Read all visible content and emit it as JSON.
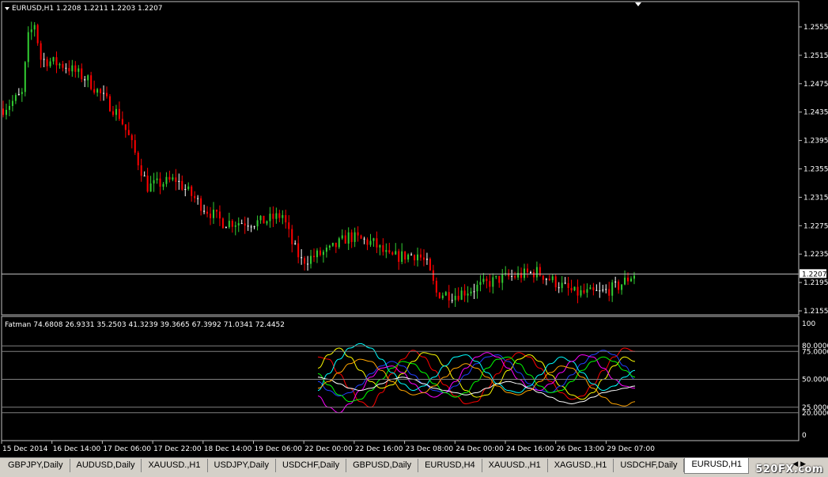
{
  "symbol_header": "EURUSD,H1  1.2208 1.2211 1.2203 1.2207",
  "indicator_header": "Fatman 74.6808 26.9331 35.2503 41.3239 39.3665 67.3992 71.0341 72.4452",
  "current_price": "1.2207",
  "price_ticks": [
    "1.2555",
    "1.2515",
    "1.2475",
    "1.2435",
    "1.2395",
    "1.2355",
    "1.2315",
    "1.2275",
    "1.2235",
    "1.2195",
    "1.2155"
  ],
  "indicator_ticks": [
    "100",
    "80.0000",
    "75.0000",
    "50.0000",
    "25.0000",
    "20.0000",
    "0"
  ],
  "time_labels": [
    "15 Dec 2014",
    "16 Dec 14:00",
    "17 Dec 06:00",
    "17 Dec 22:00",
    "18 Dec 14:00",
    "19 Dec 06:00",
    "22 Dec 00:00",
    "22 Dec 16:00",
    "23 Dec 08:00",
    "24 Dec 00:00",
    "24 Dec 16:00",
    "26 Dec 13:00",
    "29 Dec 07:00"
  ],
  "colors": {
    "bull": "#32cd32",
    "bear": "#ff0000",
    "doji": "#ffffff",
    "grid": "#c0c0c0"
  },
  "chart_data": {
    "type": "candlestick",
    "anchors": [
      [
        0,
        1.244
      ],
      [
        6,
        1.246
      ],
      [
        8,
        1.254
      ],
      [
        10,
        1.256
      ],
      [
        12,
        1.251
      ],
      [
        20,
        1.25
      ],
      [
        27,
        1.248
      ],
      [
        37,
        1.243
      ],
      [
        40,
        1.24
      ],
      [
        46,
        1.233
      ],
      [
        55,
        1.234
      ],
      [
        64,
        1.23
      ],
      [
        70,
        1.228
      ],
      [
        82,
        1.228
      ],
      [
        89,
        1.229
      ],
      [
        92,
        1.225
      ],
      [
        95,
        1.2225
      ],
      [
        104,
        1.224
      ],
      [
        110,
        1.226
      ],
      [
        118,
        1.225
      ],
      [
        123,
        1.223
      ],
      [
        132,
        1.2235
      ],
      [
        135,
        1.222
      ],
      [
        138,
        1.218
      ],
      [
        144,
        1.2178
      ],
      [
        152,
        1.219
      ],
      [
        158,
        1.22
      ],
      [
        164,
        1.2205
      ],
      [
        170,
        1.221
      ],
      [
        176,
        1.2195
      ],
      [
        182,
        1.218
      ],
      [
        190,
        1.218
      ],
      [
        196,
        1.219
      ],
      [
        201,
        1.2207
      ]
    ],
    "series": [
      {
        "name": "red",
        "color": "#ff0000",
        "values": [
          70,
          68,
          55,
          42,
          30,
          25,
          38,
          55,
          68,
          76,
          70,
          58,
          45,
          35,
          28,
          30,
          42,
          55,
          68,
          74,
          70,
          60,
          48,
          38,
          32,
          35,
          45,
          58,
          70,
          78,
          75
        ]
      },
      {
        "name": "yellow",
        "color": "#ffff00",
        "values": [
          60,
          72,
          78,
          70,
          58,
          48,
          42,
          45,
          55,
          66,
          74,
          72,
          62,
          50,
          40,
          34,
          36,
          46,
          58,
          68,
          72,
          66,
          54,
          44,
          36,
          32,
          38,
          50,
          62,
          70,
          66
        ]
      },
      {
        "name": "blue",
        "color": "#2040ff",
        "values": [
          48,
          40,
          35,
          38,
          45,
          55,
          62,
          66,
          62,
          54,
          46,
          40,
          38,
          44,
          54,
          64,
          70,
          72,
          66,
          56,
          46,
          40,
          38,
          44,
          54,
          64,
          72,
          76,
          72,
          62,
          50
        ]
      },
      {
        "name": "cyan",
        "color": "#00ffff",
        "values": [
          40,
          55,
          68,
          78,
          82,
          78,
          68,
          56,
          46,
          40,
          44,
          52,
          62,
          70,
          72,
          66,
          56,
          46,
          40,
          38,
          44,
          54,
          64,
          70,
          66,
          56,
          46,
          40,
          44,
          52,
          58
        ]
      },
      {
        "name": "magenta",
        "color": "#ff00ff",
        "values": [
          35,
          25,
          20,
          28,
          40,
          52,
          60,
          62,
          56,
          46,
          38,
          34,
          38,
          48,
          60,
          70,
          74,
          70,
          60,
          50,
          42,
          40,
          46,
          56,
          66,
          72,
          70,
          60,
          50,
          44,
          42
        ]
      },
      {
        "name": "green",
        "color": "#00ff00",
        "values": [
          55,
          45,
          36,
          30,
          32,
          40,
          50,
          60,
          66,
          64,
          56,
          46,
          38,
          34,
          38,
          48,
          60,
          68,
          70,
          64,
          54,
          44,
          38,
          40,
          48,
          58,
          66,
          70,
          66,
          58,
          52
        ]
      },
      {
        "name": "white",
        "color": "#ffffff",
        "values": [
          52,
          50,
          46,
          42,
          40,
          42,
          46,
          50,
          52,
          50,
          46,
          42,
          40,
          38,
          36,
          38,
          42,
          46,
          48,
          46,
          42,
          38,
          34,
          30,
          28,
          30,
          34,
          38,
          40,
          42,
          44
        ]
      },
      {
        "name": "orange",
        "color": "#ffa500",
        "values": [
          42,
          48,
          56,
          64,
          68,
          66,
          58,
          48,
          40,
          36,
          38,
          44,
          52,
          60,
          64,
          60,
          52,
          44,
          38,
          36,
          40,
          48,
          56,
          62,
          60,
          52,
          42,
          34,
          28,
          26,
          30
        ]
      }
    ]
  }
}
